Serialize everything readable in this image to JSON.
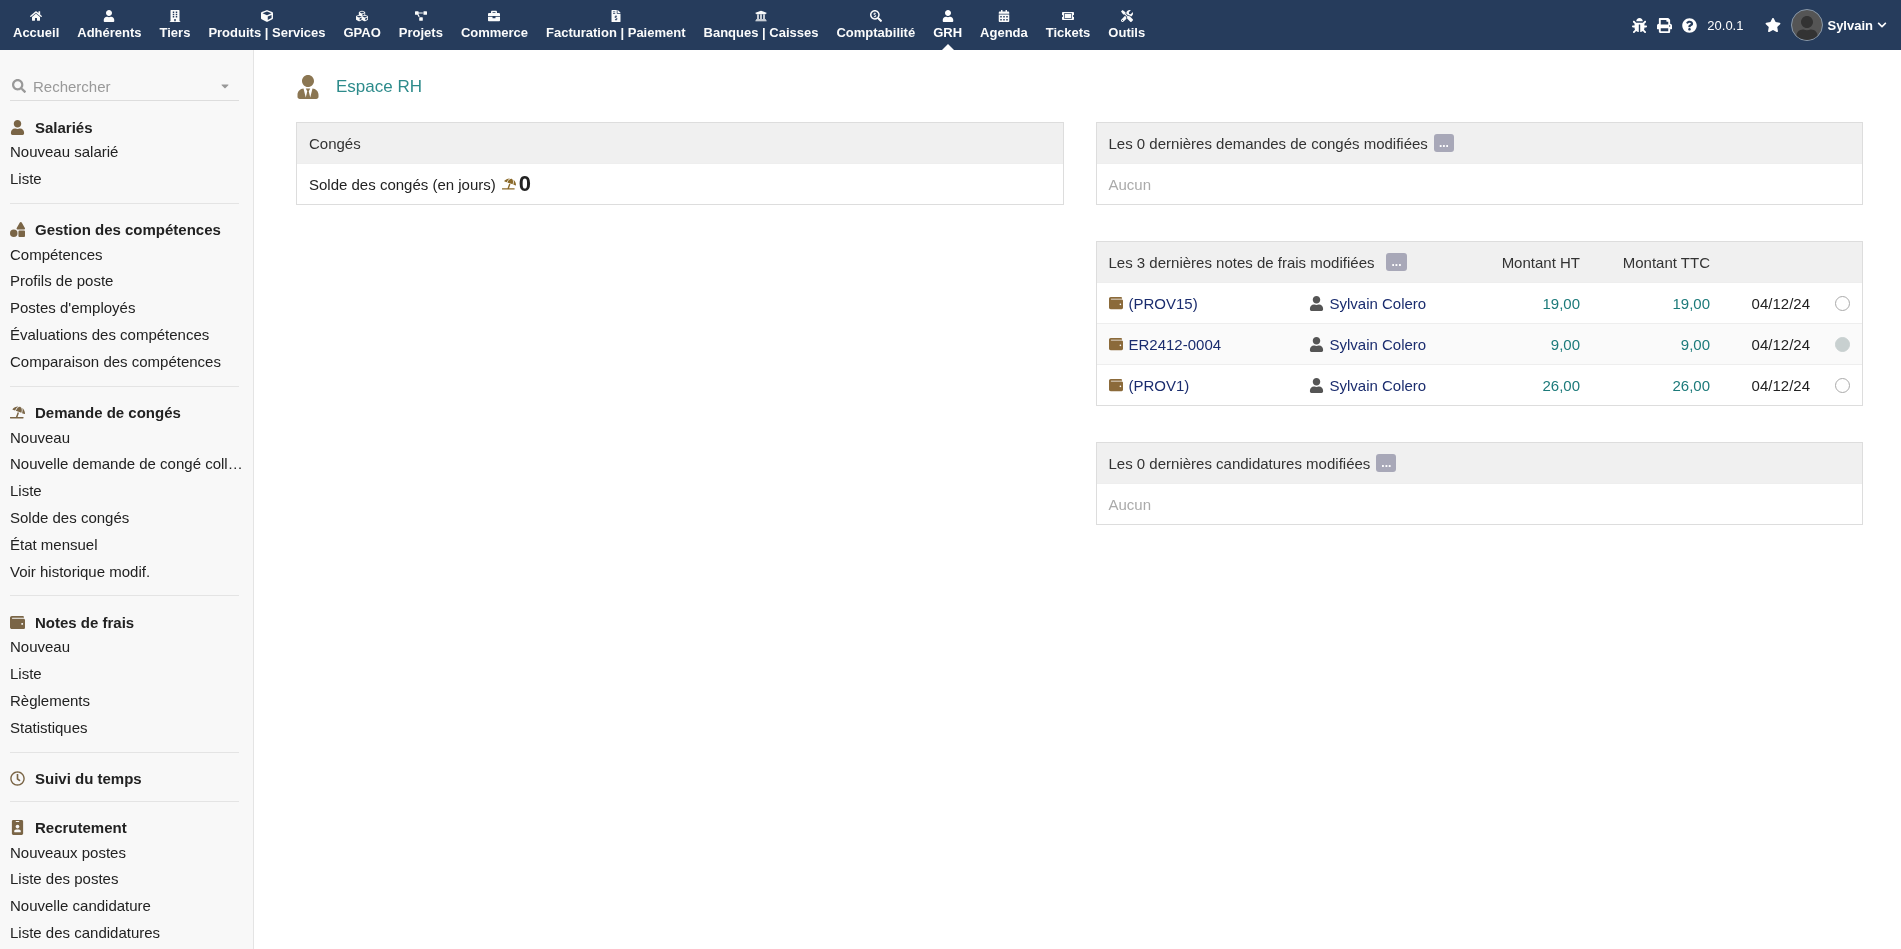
{
  "topnav": {
    "items": [
      {
        "label": "Accueil",
        "selected": false
      },
      {
        "label": "Adhérents",
        "selected": false
      },
      {
        "label": "Tiers",
        "selected": false
      },
      {
        "label": "Produits | Services",
        "selected": false
      },
      {
        "label": "GPAO",
        "selected": false
      },
      {
        "label": "Projets",
        "selected": false
      },
      {
        "label": "Commerce",
        "selected": false
      },
      {
        "label": "Facturation | Paiement",
        "selected": false
      },
      {
        "label": "Banques | Caisses",
        "selected": false
      },
      {
        "label": "Comptabilité",
        "selected": false
      },
      {
        "label": "GRH",
        "selected": true
      },
      {
        "label": "Agenda",
        "selected": false
      },
      {
        "label": "Tickets",
        "selected": false
      },
      {
        "label": "Outils",
        "selected": false
      }
    ],
    "version": "20.0.1",
    "user": "Sylvain"
  },
  "sidebar": {
    "search_placeholder": "Rechercher",
    "sections": [
      {
        "title": "Salariés",
        "items": [
          "Nouveau salarié",
          "Liste"
        ]
      },
      {
        "title": "Gestion des compétences",
        "items": [
          "Compétences",
          "Profils de poste",
          "Postes d'employés",
          "Évaluations des compétences",
          "Comparaison des compétences"
        ]
      },
      {
        "title": "Demande de congés",
        "items": [
          "Nouveau",
          "Nouvelle demande de congé coll…",
          "Liste",
          "Solde des congés",
          "État mensuel",
          "Voir historique modif."
        ]
      },
      {
        "title": "Notes de frais",
        "items": [
          "Nouveau",
          "Liste",
          "Règlements",
          "Statistiques"
        ]
      },
      {
        "title": "Suivi du temps"
      },
      {
        "title": "Recrutement",
        "items": [
          "Nouveaux postes",
          "Liste des postes",
          "Nouvelle candidature",
          "Liste des candidatures"
        ]
      }
    ]
  },
  "page_title": "Espace RH",
  "leave_box": {
    "title": "Congés",
    "label": "Solde des congés (en jours)",
    "value": "0"
  },
  "leave_requests": {
    "title": "Les 0 dernières demandes de congés modifiées",
    "more": "...",
    "empty": "Aucun"
  },
  "expenses": {
    "title": "Les 3 dernières notes de frais modifiées",
    "more": "...",
    "columns": [
      "Montant HT",
      "Montant TTC"
    ],
    "rows": [
      {
        "ref": "(PROV15)",
        "user": "Sylvain Colero",
        "ht": "19,00",
        "ttc": "19,00",
        "date": "04/12/24",
        "validated": false
      },
      {
        "ref": "ER2412-0004",
        "user": "Sylvain Colero",
        "ht": "9,00",
        "ttc": "9,00",
        "date": "04/12/24",
        "validated": true
      },
      {
        "ref": "(PROV1)",
        "user": "Sylvain Colero",
        "ht": "26,00",
        "ttc": "26,00",
        "date": "04/12/24",
        "validated": false
      }
    ]
  },
  "applications": {
    "title": "Les 0 dernières candidatures modifiées",
    "more": "...",
    "empty": "Aucun"
  }
}
